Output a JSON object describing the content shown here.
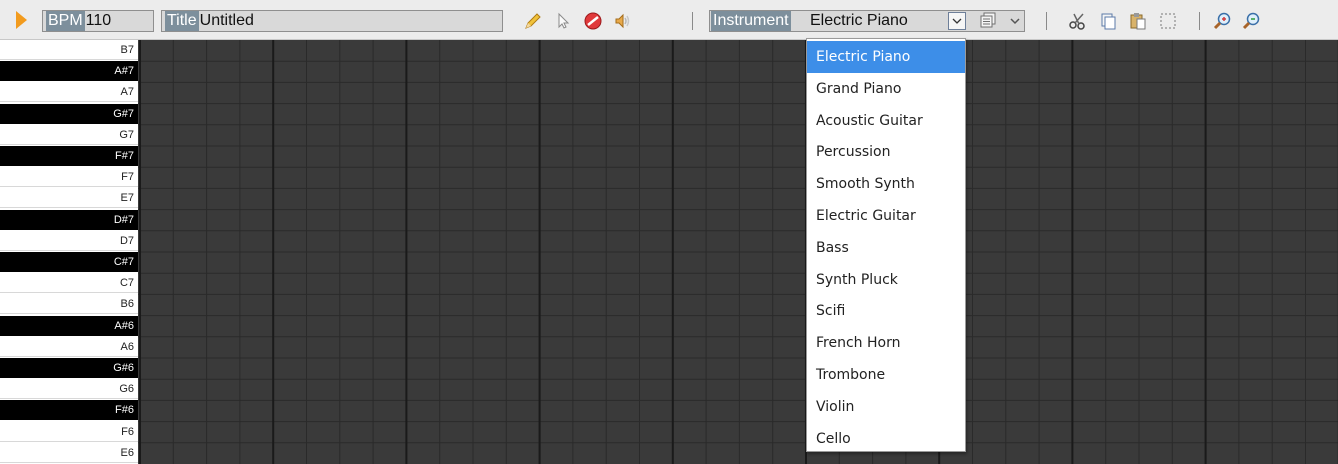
{
  "toolbar": {
    "bpm_label": "BPM",
    "bpm_value": "110",
    "title_label": "Title",
    "title_value": "Untitled",
    "instrument_label": "Instrument",
    "instrument_value": "Electric Piano",
    "tools": [
      "pencil-icon",
      "pointer-icon",
      "delete-icon",
      "speaker-icon"
    ],
    "actions": [
      "cut-icon",
      "copy-icon",
      "paste-icon",
      "select-icon",
      "zoom-in-icon",
      "zoom-out-icon"
    ]
  },
  "keys": [
    {
      "note": "B7",
      "black": false
    },
    {
      "note": "A#7",
      "black": true
    },
    {
      "note": "A7",
      "black": false
    },
    {
      "note": "G#7",
      "black": true
    },
    {
      "note": "G7",
      "black": false
    },
    {
      "note": "F#7",
      "black": true
    },
    {
      "note": "F7",
      "black": false
    },
    {
      "note": "E7",
      "black": false
    },
    {
      "note": "D#7",
      "black": true
    },
    {
      "note": "D7",
      "black": false
    },
    {
      "note": "C#7",
      "black": true
    },
    {
      "note": "C7",
      "black": false
    },
    {
      "note": "B6",
      "black": false
    },
    {
      "note": "A#6",
      "black": true
    },
    {
      "note": "A6",
      "black": false
    },
    {
      "note": "G#6",
      "black": true
    },
    {
      "note": "G6",
      "black": false
    },
    {
      "note": "F#6",
      "black": true
    },
    {
      "note": "F6",
      "black": false
    },
    {
      "note": "E6",
      "black": false
    }
  ],
  "instrument_options": [
    "Electric Piano",
    "Grand Piano",
    "Acoustic Guitar",
    "Percussion",
    "Smooth Synth",
    "Electric Guitar",
    "Bass",
    "Synth Pluck",
    "Scifi",
    "French Horn",
    "Trombone",
    "Violin",
    "Cello"
  ],
  "selected_instrument_index": 0,
  "colors": {
    "grid_bg": "#3a3a3a",
    "grid_line": "#2a2a2a",
    "grid_bar_line": "#1a1a1a",
    "accent": "#3d8ee8",
    "play": "#f29b1e"
  }
}
